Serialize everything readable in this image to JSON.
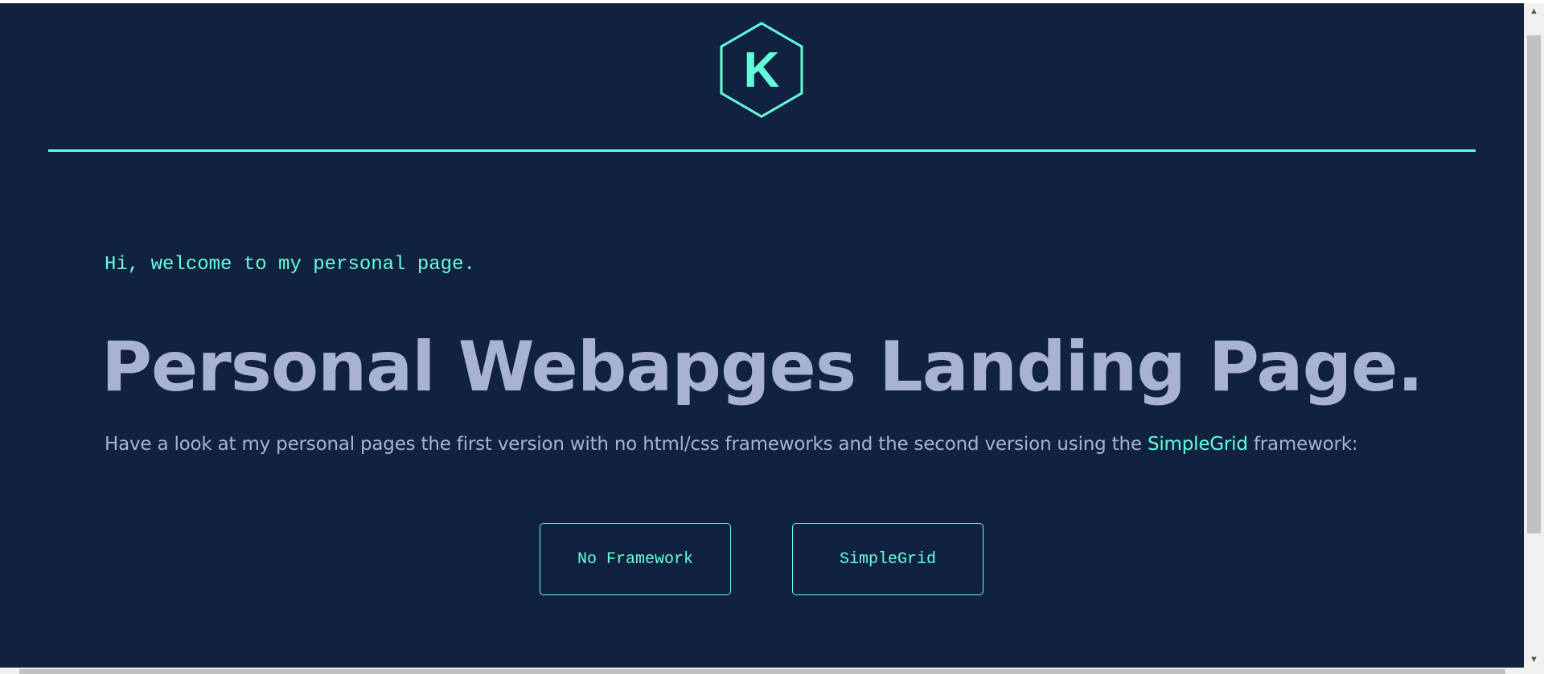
{
  "logo": {
    "letter": "K",
    "icon": "hexagon-logo-icon",
    "color": "#64ffda"
  },
  "greeting": "Hi, welcome to my personal page.",
  "headline": "Personal Webapges Landing Page.",
  "intro": {
    "before": "Have a look at my personal pages the first version with no html/css frameworks and the second version using the ",
    "link": "SimpleGrid",
    "after": " framework:"
  },
  "buttons": [
    {
      "label": "No Framework"
    },
    {
      "label": "SimpleGrid"
    }
  ],
  "colors": {
    "background": "#112240",
    "accent": "#64ffda",
    "text": "#a8b2d1"
  },
  "scrollbar": {
    "up_icon": "scroll-up-arrow-icon",
    "down_icon": "scroll-down-arrow-icon"
  }
}
